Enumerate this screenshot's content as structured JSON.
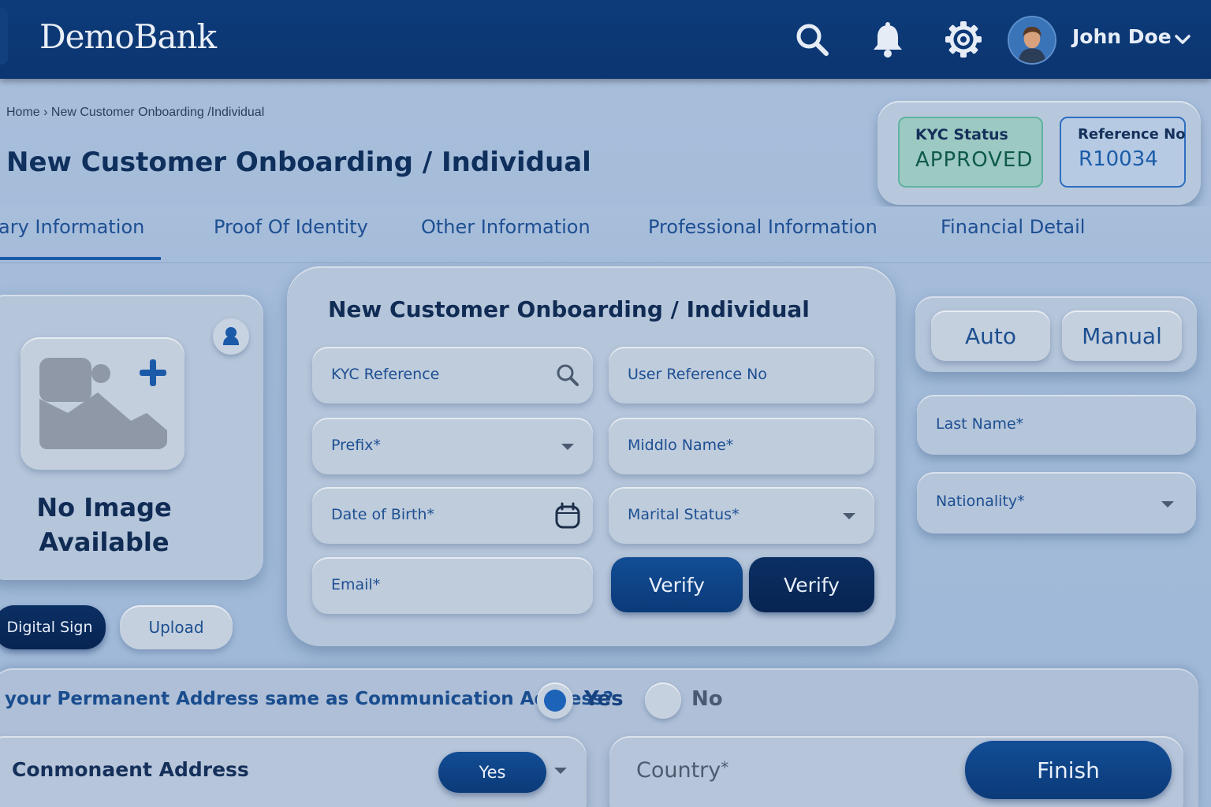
{
  "header": {
    "brand": "DemoBank",
    "user_name": "John Doe",
    "icons": [
      "search-icon",
      "bell-icon",
      "gear-icon",
      "chevron-down-icon"
    ]
  },
  "breadcrumb": "Home › New Customer Onboarding /Individual",
  "page_title": "New Customer Onboarding / Individual",
  "status": {
    "kyc_label": "KYC Status",
    "kyc_value": "APPROVED",
    "ref_label": "Reference No",
    "ref_value": "R10034"
  },
  "tabs": [
    {
      "label": "ary Information",
      "active": true
    },
    {
      "label": "Proof Of Identity"
    },
    {
      "label": "Other Information"
    },
    {
      "label": "Professional Information"
    },
    {
      "label": "Financial Detail"
    }
  ],
  "image_card": {
    "no_image_line1": "No Image",
    "no_image_line2": "Available",
    "digital_sign": "Digital Sign",
    "upload": "Upload"
  },
  "form": {
    "title": "New Customer Onboarding / Individual",
    "kyc_reference": "KYC Reference",
    "user_reference": "User Reference No",
    "prefix": "Prefix*",
    "middle_name": "Middlo Name*",
    "dob": "Date of Birth*",
    "marital_status": "Marital Status*",
    "email": "Email*",
    "verify_1": "Verify",
    "verify_2": "Verify"
  },
  "mode": {
    "auto": "Auto",
    "manual": "Manual"
  },
  "right_fields": {
    "last_name": "Last Name*",
    "nationality": "Nationality*"
  },
  "address": {
    "question": "your Permanent Address same as Communication Address?",
    "yes": "Yes",
    "no": "No",
    "selected": "Yes",
    "component_label": "Conmonaent Address",
    "component_value": "Yes",
    "country": "Country",
    "country_required": "*",
    "finish": "Finish"
  },
  "colors": {
    "header_bg": "#0d3b7a",
    "accent": "#1b5aa8",
    "approved_bg": "#9cc9c2"
  }
}
